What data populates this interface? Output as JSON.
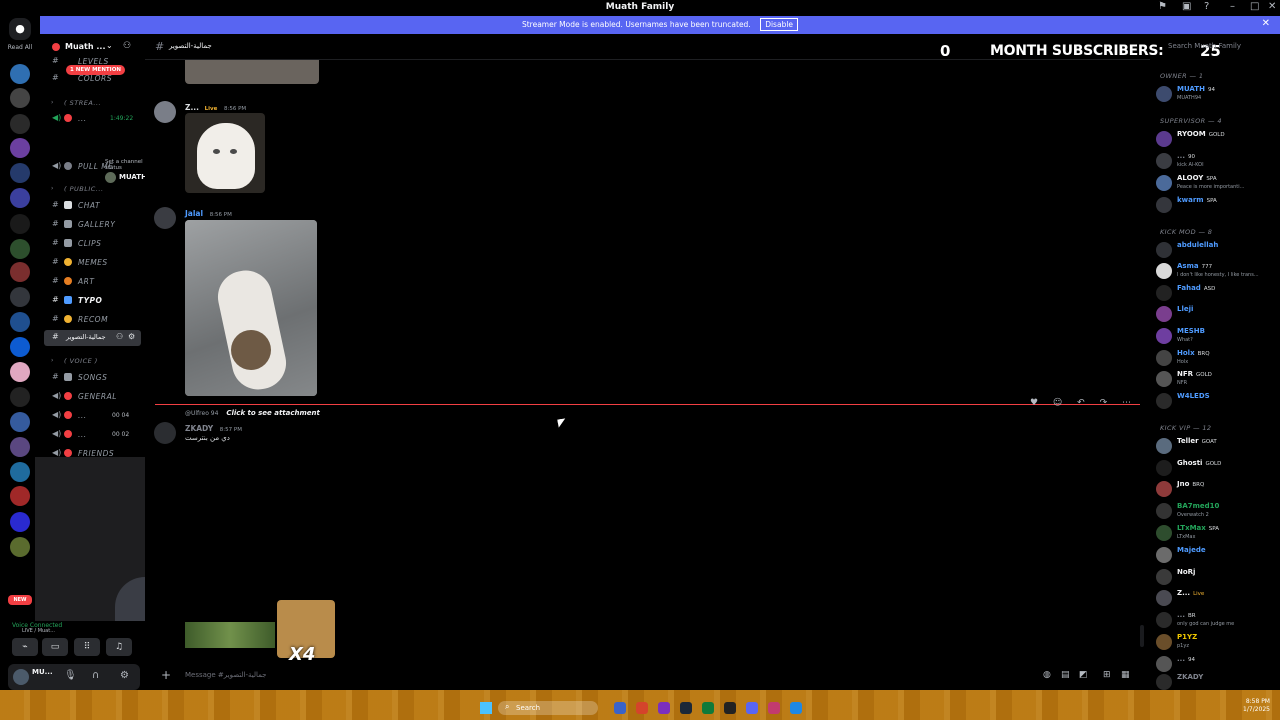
{
  "window": {
    "title": "Muath Family"
  },
  "banner": {
    "text": "Streamer Mode is enabled. Usernames have been truncated.",
    "disable_label": "Disable"
  },
  "guilds": {
    "read_all": "Read All",
    "new_badge": "NEW"
  },
  "server": {
    "name": "Muath ..."
  },
  "channels": {
    "new_mention": "1 NEW MENTION",
    "items": [
      {
        "label": "LEVELS"
      },
      {
        "label": "COLORS"
      },
      {
        "label": "( STREA..."
      },
      {
        "label": "...",
        "time": "1:49:22"
      },
      {
        "label": "PULL ME"
      },
      {
        "label": "( PUBLIC..."
      },
      {
        "label": "CHAT"
      },
      {
        "label": "GALLERY"
      },
      {
        "label": "CLIPS"
      },
      {
        "label": "MEMES"
      },
      {
        "label": "ART"
      },
      {
        "label": "TYPO"
      },
      {
        "label": "RECOM"
      },
      {
        "label": "جمالية-التصوير"
      },
      {
        "label": "( VOICE )"
      },
      {
        "label": "SONGS"
      },
      {
        "label": "GENERAL"
      },
      {
        "label": "...",
        "count": "00 04"
      },
      {
        "label": "...",
        "count": "00 02"
      },
      {
        "label": "FRIENDS"
      }
    ],
    "status_hint": "Set a channel status",
    "voice_user": {
      "name": "MUATH",
      "badge": "94"
    }
  },
  "voice_bar": {
    "status": "Voice Connected",
    "sub": "LIVE / Muat..."
  },
  "user_panel": {
    "name": "MU..."
  },
  "main": {
    "channel_name": "جمالية-التصوير",
    "messages": [
      {
        "author": "Z...",
        "tag": "Live",
        "time": "8:56 PM"
      },
      {
        "author": "Jalal",
        "time": "8:56 PM"
      },
      {
        "reply_user": "@Ulfreo",
        "reply_badge": "94",
        "reply_text": "Click to see attachment",
        "author": "ZKADY",
        "time": "8:57 PM",
        "text": "دي من بنترست"
      }
    ],
    "composer_placeholder": "Message #جمالية-التصوير"
  },
  "overlay": {
    "left_count": "0",
    "label": "MONTH SUBSCRIBERS:",
    "right_count": "25"
  },
  "members": {
    "search_placeholder": "Search Muath Family",
    "roles": [
      {
        "title": "OWNER — 1"
      },
      {
        "title": "SUPERVISOR — 4"
      },
      {
        "title": "KICK MOD — 8"
      },
      {
        "title": "KICK VIP — 12"
      }
    ],
    "list": [
      {
        "name": "MUATH",
        "tag": "94",
        "sub": "MUATH94",
        "color": "#4f9bff"
      },
      {
        "name": "RYOOM",
        "tag": "GOLD",
        "sub": "",
        "color": "#f2f3f5"
      },
      {
        "name": "...",
        "tag": "90",
        "sub": "kick Al-KOI",
        "color": "#80848e"
      },
      {
        "name": "ALOOY",
        "tag": "SPA",
        "sub": "Peace is more importanti...",
        "color": "#f2f3f5"
      },
      {
        "name": "kwarm",
        "tag": "SPA",
        "sub": "",
        "color": "#4f9bff"
      },
      {
        "name": "abdulellah",
        "tag": "",
        "sub": "",
        "color": "#4f9bff"
      },
      {
        "name": "Asma",
        "tag": "777",
        "sub": "I don't like honesty, I like trans...",
        "color": "#4f9bff"
      },
      {
        "name": "Fahad",
        "tag": "ASD",
        "sub": "",
        "color": "#4f9bff"
      },
      {
        "name": "Lleji",
        "tag": "",
        "sub": "",
        "color": "#4f9bff"
      },
      {
        "name": "MESHB",
        "tag": "",
        "sub": "What?",
        "color": "#4f9bff"
      },
      {
        "name": "Holx",
        "tag": "BRQ",
        "sub": "Holx",
        "color": "#4f9bff"
      },
      {
        "name": "NFR",
        "tag": "GOLD",
        "sub": "NFR",
        "color": "#f2f3f5"
      },
      {
        "name": "W4LEDS",
        "tag": "",
        "sub": "",
        "color": "#4f9bff"
      },
      {
        "name": "Teller",
        "tag": "GOAT",
        "sub": "",
        "color": "#f2f3f5"
      },
      {
        "name": "Ghosti",
        "tag": "GOLD",
        "sub": "",
        "color": "#f2f3f5"
      },
      {
        "name": "Jno",
        "tag": "BRQ",
        "sub": "",
        "color": "#f2f3f5"
      },
      {
        "name": "BA7med10",
        "tag": "",
        "sub": "Overwatch 2",
        "color": "#23a55a"
      },
      {
        "name": "LTxMax",
        "tag": "SPA",
        "sub": "LTxMax",
        "color": "#23a55a"
      },
      {
        "name": "Majede",
        "tag": "",
        "sub": "",
        "color": "#4f9bff"
      },
      {
        "name": "NoRj",
        "tag": "",
        "sub": "",
        "color": "#f2f3f5"
      },
      {
        "name": "Z...",
        "tag": "Live",
        "sub": "",
        "color": "#f2f3f5"
      },
      {
        "name": "...",
        "tag": "BR",
        "sub": "only god can judge me",
        "color": "#80848e"
      },
      {
        "name": "P1YZ",
        "tag": "",
        "sub": "p1yz",
        "color": "#f0c800"
      },
      {
        "name": "...",
        "tag": "94",
        "sub": "",
        "color": "#80848e"
      },
      {
        "name": "ZKADY",
        "tag": "",
        "sub": "",
        "color": "#80848e"
      }
    ]
  },
  "taskbar": {
    "search": "Search",
    "time": "8:58 PM",
    "date": "1/7/2025"
  },
  "colors": {
    "brand": "#5865f2",
    "mention": "#f23f43",
    "online": "#23a55a"
  }
}
